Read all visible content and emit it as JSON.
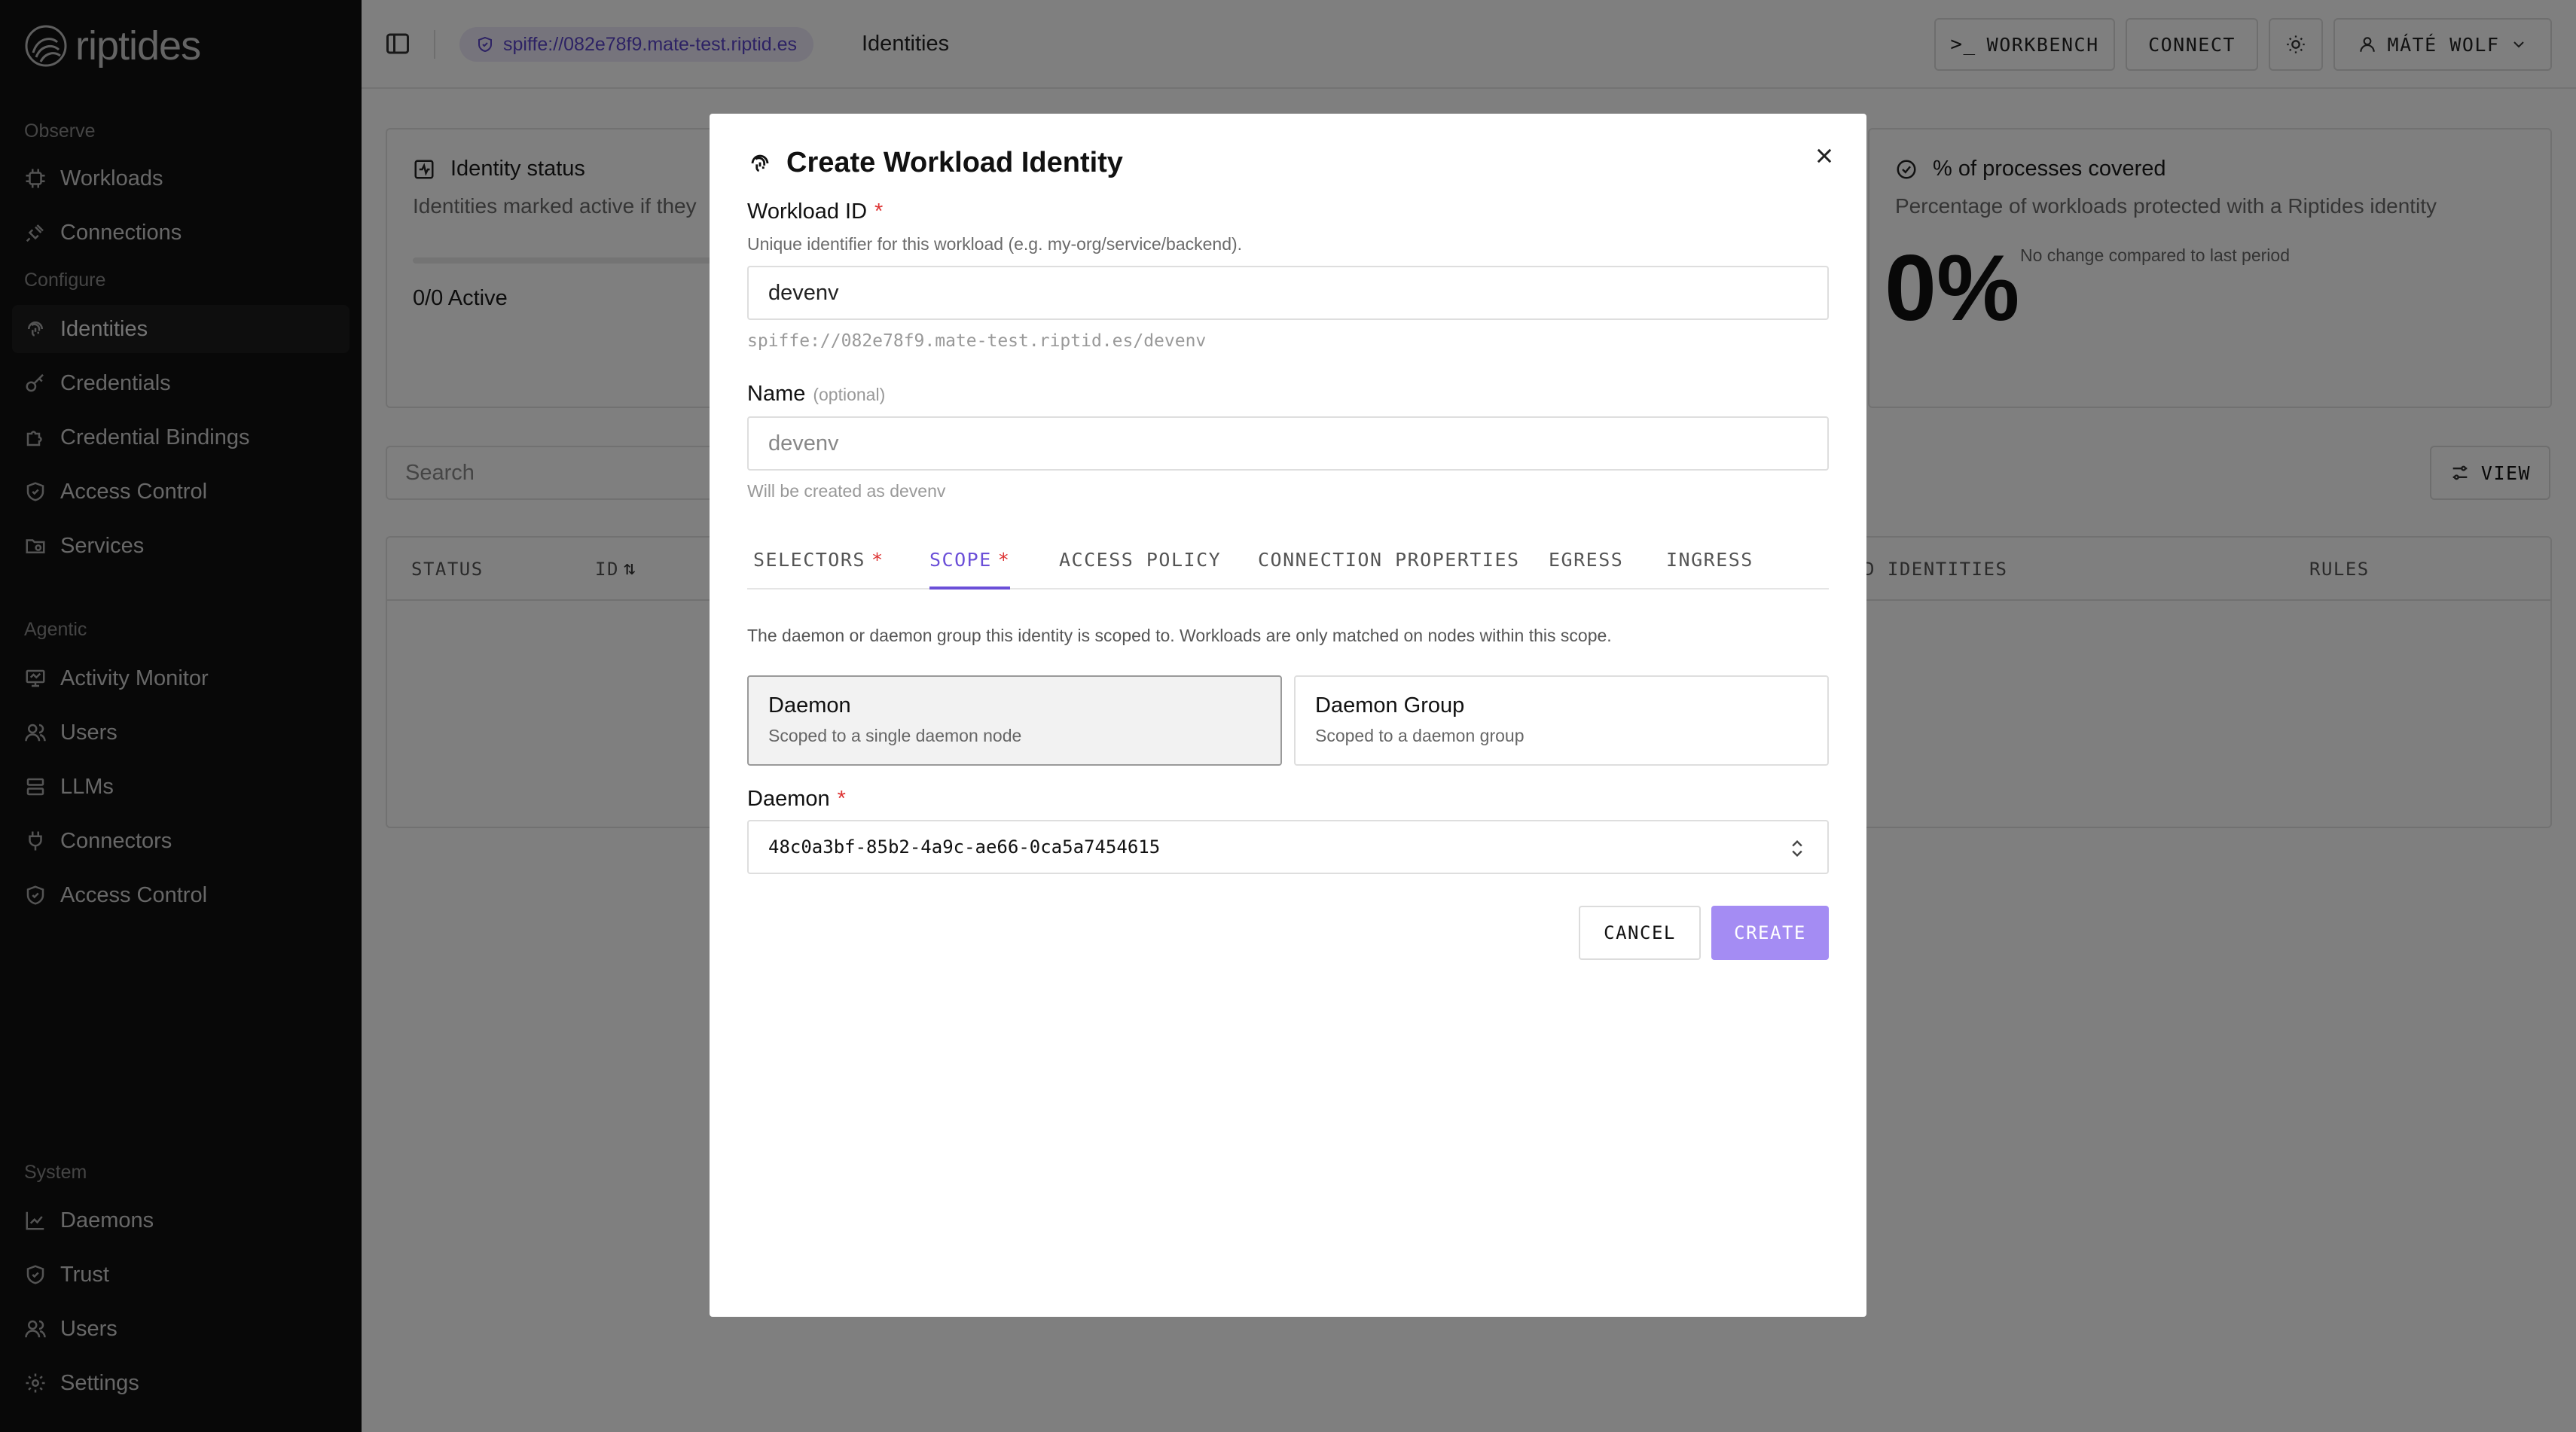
{
  "app": {
    "name": "riptides"
  },
  "sidebar": {
    "sections": [
      {
        "title": "Observe",
        "items": [
          "Workloads",
          "Connections"
        ]
      },
      {
        "title": "Configure",
        "items": [
          "Identities",
          "Credentials",
          "Credential Bindings",
          "Access Control",
          "Services"
        ]
      },
      {
        "title": "Agentic",
        "items": [
          "Activity Monitor",
          "Users",
          "LLMs",
          "Connectors",
          "Access Control"
        ]
      },
      {
        "title": "System",
        "items": [
          "Daemons",
          "Trust",
          "Users",
          "Settings"
        ]
      }
    ],
    "active_item": "Identities"
  },
  "topbar": {
    "spiffe": "spiffe://082e78f9.mate-test.riptid.es",
    "breadcrumb": "Identities",
    "workbench_label": "WORKBENCH",
    "connect_label": "CONNECT",
    "user_label": "MÁTÉ WOLF"
  },
  "cards": {
    "status_title": "Identity status",
    "status_sub": "Identities marked active if they",
    "status_value": "0/0 Active",
    "coverage_title": "% of processes covered",
    "coverage_sub": "Percentage of workloads protected with a Riptides identity",
    "coverage_value": "0%",
    "coverage_change": "No change compared to last period"
  },
  "list": {
    "search_placeholder": "Search",
    "view_label": "VIEW",
    "columns": {
      "status": "STATUS",
      "id": "ID",
      "identities": "D IDENTITIES",
      "rules": "RULES"
    }
  },
  "modal": {
    "title": "Create Workload Identity",
    "workload_id_label": "Workload ID",
    "workload_id_hint": "Unique identifier for this workload (e.g. my-org/service/backend).",
    "workload_id_value": "devenv",
    "spiffe_preview": "spiffe://082e78f9.mate-test.riptid.es/devenv",
    "name_label": "Name",
    "name_optional": "(optional)",
    "name_placeholder": "devenv",
    "name_hint": "Will be created as devenv",
    "tabs": [
      {
        "label": "SELECTORS",
        "required": "*"
      },
      {
        "label": "SCOPE",
        "required": "*"
      },
      {
        "label": "ACCESS POLICY"
      },
      {
        "label": "CONNECTION PROPERTIES"
      },
      {
        "label": "EGRESS"
      },
      {
        "label": "INGRESS"
      }
    ],
    "active_tab": "SCOPE",
    "scope_description": "The daemon or daemon group this identity is scoped to. Workloads are only matched on nodes within this scope.",
    "scope_options": [
      {
        "title": "Daemon",
        "sub": "Scoped to a single daemon node",
        "selected": true
      },
      {
        "title": "Daemon Group",
        "sub": "Scoped to a daemon group",
        "selected": false
      }
    ],
    "daemon_label": "Daemon",
    "daemon_value": "48c0a3bf-85b2-4a9c-ae66-0ca5a7454615",
    "required_mark": "*",
    "cancel_label": "CANCEL",
    "create_label": "CREATE"
  },
  "colors": {
    "accent": "#6b4fd8",
    "create_button": "#a48cf3",
    "sidebar_bg": "#111111",
    "overlay": "rgba(0,0,0,0.5)"
  }
}
